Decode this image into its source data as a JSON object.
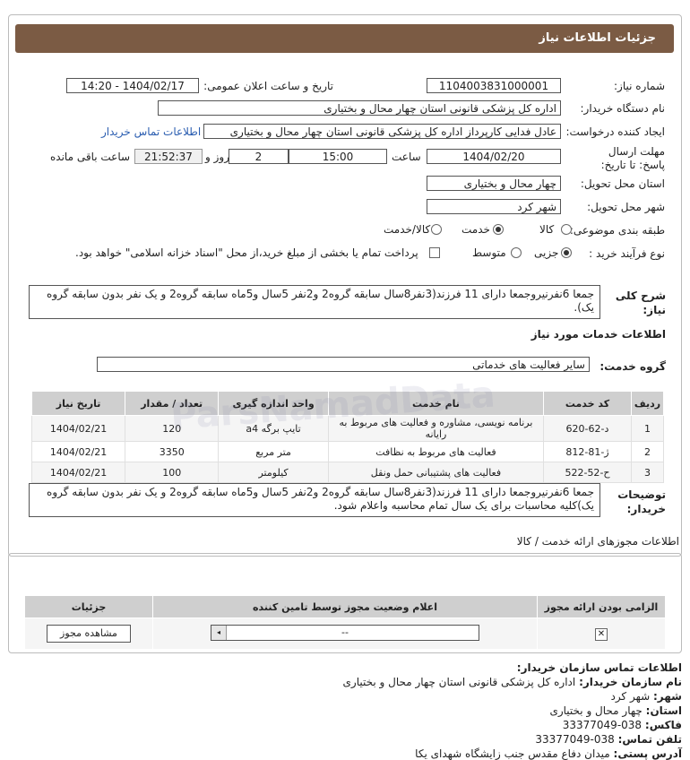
{
  "header": {
    "title": "جزئیات اطلاعات نیاز"
  },
  "fields": {
    "need_number_label": "شماره نیاز:",
    "need_number": "1104003831000001",
    "announce_label": "تاریخ و ساعت اعلان عمومی:",
    "announce_value": "1404/02/17 - 14:20",
    "buyer_org_label": "نام دستگاه خریدار:",
    "buyer_org": "اداره کل پزشکی قانونی استان چهار محال و بختیاری",
    "creator_label": "ایجاد کننده درخواست:",
    "creator": "عادل فدایی کارپرداز اداره کل پزشکی قانونی استان چهار محال و بختیاری",
    "contact_link": "اطلاعات تماس خریدار",
    "deadline_label": "مهلت ارسال پاسخ: تا تاریخ:",
    "deadline_date": "1404/02/20",
    "time_label": "ساعت",
    "deadline_time": "15:00",
    "days_value": "2",
    "days_label": "روز و",
    "remaining_time": "21:52:37",
    "remaining_label": "ساعت باقی مانده",
    "province_label": "استان محل تحویل:",
    "province": "چهار محال و بختیاری",
    "city_label": "شهر محل تحویل:",
    "city": "شهر کرد",
    "category_label": "طبقه بندی موضوعی:",
    "category_options": [
      "کالا",
      "خدمت",
      "کالا/خدمت"
    ],
    "process_label": "نوع فرآیند خرید :",
    "process_options": [
      "جزیی",
      "متوسط"
    ],
    "payment_note": "پرداخت تمام یا بخشی از مبلغ خرید،از محل \"اسناد خزانه اسلامی\" خواهد بود."
  },
  "summary": {
    "label": "شرح کلی نیاز:",
    "text": "جمعا 6نفرنیروجمعا دارای 11 فرزند(3نفر8سال سابقه گروه2 و2نفر 5سال و5ماه سابقه گروه2 و یک نفر بدون سابقه گروه یک)."
  },
  "services": {
    "section_title": "اطلاعات خدمات مورد نیاز",
    "group_label": "گروه خدمت:",
    "group_value": "سایر فعالیت های خدماتی",
    "columns": [
      "ردیف",
      "کد خدمت",
      "نام خدمت",
      "واحد اندازه گیری",
      "تعداد / مقدار",
      "تاریخ نیاز"
    ],
    "rows": [
      [
        "1",
        "د-62-620",
        "برنامه نویسی، مشاوره و فعالیت های مربوط به رایانه",
        "تایپ برگه a4",
        "120",
        "1404/02/21"
      ],
      [
        "2",
        "ژ-81-812",
        "فعالیت های مربوط به نظافت",
        "متر مربع",
        "3350",
        "1404/02/21"
      ],
      [
        "3",
        "ح-52-522",
        "فعالیت های پشتیبانی حمل ونقل",
        "کیلومتر",
        "100",
        "1404/02/21"
      ]
    ]
  },
  "buyer_notes": {
    "label": "توضیحات خریدار:",
    "text": "جمعا 6نفرنیروجمعا دارای 11 فرزند(3نفر8سال سابقه گروه2 و2نفر 5سال و5ماه سابقه گروه2 و یک نفر بدون سابقه گروه یک)کلیه محاسبات برای یک سال تمام محاسبه واعلام شود."
  },
  "permits": {
    "title": "اطلاعات مجوزهای ارائه خدمت / کالا",
    "columns": [
      "الزامی بودن ارائه مجوز",
      "اعلام وضعیت مجوز توسط تامین کننده",
      "جزئیات"
    ],
    "select_value": "--",
    "view_button": "مشاهده مجوز"
  },
  "contact": {
    "title": "اطلاعات تماس سازمان خریدار:",
    "org_label": "نام سازمان خریدار:",
    "org": "اداره کل پزشکی قانونی استان چهار محال و بختیاری",
    "city_label": "شهر:",
    "city": "شهر کرد",
    "province_label": "استان:",
    "province": "چهار محال و بختیاری",
    "fax_label": "فاکس:",
    "fax": "038-33377049",
    "phone_label": "تلفن تماس:",
    "phone": "038-33377049",
    "address_label": "آدرس پستی:",
    "address": "میدان دفاع مقدس جنب زایشگاه شهدای یکا"
  },
  "watermark": "ParsNamadData"
}
